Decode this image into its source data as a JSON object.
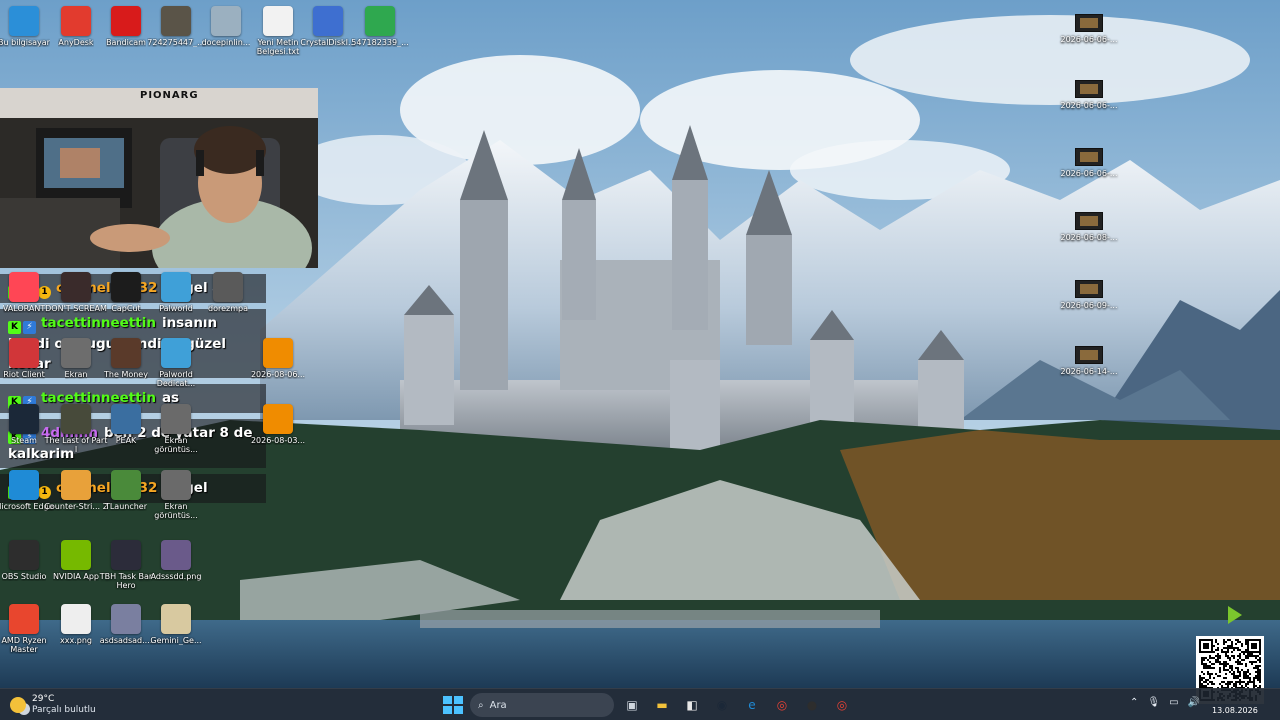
{
  "desktop": {
    "top_row": [
      {
        "label": "Bu bilgisayar",
        "icon": "monitor-icon",
        "color": "#2b8fd8"
      },
      {
        "label": "AnyDesk",
        "icon": "anydesk-icon",
        "color": "#e23b2e"
      },
      {
        "label": "Bandicam",
        "icon": "record-icon",
        "color": "#d81b1b"
      },
      {
        "label": "724275447_...",
        "icon": "image-thumb-icon",
        "color": "#5a5448"
      },
      {
        "label": "docepinlin...",
        "icon": "image-thumb-icon",
        "color": "#9bb0c0"
      },
      {
        "label": "Yeni Metin Belgesi.txt",
        "icon": "text-file-icon",
        "color": "#f2f2f2"
      },
      {
        "label": "CrystalDiskI...",
        "icon": "crystaldisk-icon",
        "color": "#3e6fd0"
      },
      {
        "label": "547182339_...",
        "icon": "image-thumb-icon",
        "color": "#2fa84f"
      }
    ],
    "left_column": [
      {
        "label": "VALORANT",
        "icon": "valorant-icon",
        "color": "#ff4655"
      },
      {
        "label": "Riot Client",
        "icon": "riot-icon",
        "color": "#d13639"
      },
      {
        "label": "Steam",
        "icon": "steam-icon",
        "color": "#1b2838"
      },
      {
        "label": "Microsoft Edge",
        "icon": "edge-icon",
        "color": "#1f8bd6"
      },
      {
        "label": "OBS Studio",
        "icon": "obs-icon",
        "color": "#2d2d2d"
      },
      {
        "label": "AMD Ryzen Master",
        "icon": "amd-icon",
        "color": "#e8462e"
      }
    ],
    "second_column": [
      {
        "label": "DON'T SCREAM",
        "icon": "game-icon",
        "color": "#3a2b2b"
      },
      {
        "label": "Ekran",
        "icon": "image-thumb-icon",
        "color": "#6d6d6d"
      },
      {
        "label": "The Last of Part I",
        "icon": "game-icon",
        "color": "#474a3a"
      },
      {
        "label": "Counter-Stri... 2",
        "icon": "cs2-icon",
        "color": "#e8a13a"
      },
      {
        "label": "NVIDIA App",
        "icon": "nvidia-icon",
        "color": "#76b900"
      },
      {
        "label": "xxx.png",
        "icon": "image-thumb-icon",
        "color": "#eeeeee"
      }
    ],
    "third_column": [
      {
        "label": "CapCut",
        "icon": "capcut-icon",
        "color": "#1c1c1c"
      },
      {
        "label": "The Money",
        "icon": "game-icon",
        "color": "#5a3a2a"
      },
      {
        "label": "PEAK",
        "icon": "peak-icon",
        "color": "#3a6ea0"
      },
      {
        "label": "TLauncher",
        "icon": "tlauncher-icon",
        "color": "#4a8a3a"
      },
      {
        "label": "TBH Task Bar Hero",
        "icon": "game-icon",
        "color": "#2c2c3a"
      },
      {
        "label": "asdsadsad....",
        "icon": "image-thumb-icon",
        "color": "#7a7fa0"
      }
    ],
    "fourth_column": [
      {
        "label": "Palworld",
        "icon": "palworld-icon",
        "color": "#3fa0d8"
      },
      {
        "label": "Palworld Dedicat...",
        "icon": "palworld-icon",
        "color": "#3fa0d8"
      },
      {
        "label": "Ekran görüntüs...",
        "icon": "image-thumb-icon",
        "color": "#6a6a6a"
      },
      {
        "label": "Ekran görüntüs...",
        "icon": "image-thumb-icon",
        "color": "#6a6a6a"
      },
      {
        "label": "Adsssdd.png",
        "icon": "image-thumb-icon",
        "color": "#6a5a8a"
      },
      {
        "label": "Gemini_Ge...",
        "icon": "image-thumb-icon",
        "color": "#d8c9a0"
      }
    ],
    "fifth_column": [
      {
        "label": "dorezmpa",
        "icon": "image-thumb-icon",
        "color": "#5a5a5a"
      },
      {
        "label": "2026-08-06...",
        "icon": "vlc-icon",
        "color": "#f08c00"
      },
      {
        "label": "2026-08-03...",
        "icon": "vlc-icon",
        "color": "#f08c00"
      }
    ],
    "right_column": [
      {
        "label": "2026-06-06-..."
      },
      {
        "label": "2026-06-06-..."
      },
      {
        "label": "2026-06-06-..."
      },
      {
        "label": "2026-06-08-..."
      },
      {
        "label": "2026-06-09-..."
      },
      {
        "label": "2026-06-14-..."
      }
    ]
  },
  "webcam": {
    "shirt_text": "PIONARG"
  },
  "chat": [
    {
      "badges": [
        "k",
        "cube",
        "one"
      ],
      "user": "chameleon32",
      "user_color": "#f5a623",
      "text": "cs gel aq"
    },
    {
      "badges": [
        "k",
        "bolt"
      ],
      "user": "tacettinneettin",
      "user_color": "#53fc18",
      "text": "insanın kendi ossrugu kendine güzel kokar"
    },
    {
      "badges": [
        "k",
        "bolt"
      ],
      "user": "tacettinneettin",
      "user_color": "#53fc18",
      "text": "as"
    },
    {
      "badges": [
        "k",
        "bolt"
      ],
      "user": "4dminn",
      "user_color": "#c86bf0",
      "text": "ben 2 de yatar 8 de kalkarim"
    },
    {
      "badges": [
        "k",
        "cube",
        "one"
      ],
      "user": "chameleon32",
      "user_color": "#f5a623",
      "text": "cs gel"
    }
  ],
  "taskbar": {
    "weather_temp": "29°C",
    "weather_desc": "Parçalı bulutlu",
    "search_placeholder": "Ara",
    "date": "13.08.2026",
    "apps": [
      {
        "name": "task-view-icon",
        "color": "#cfd6de"
      },
      {
        "name": "file-explorer-icon",
        "color": "#f2c23b"
      },
      {
        "name": "app-icon",
        "color": "#e8e8e8"
      },
      {
        "name": "steam-icon",
        "color": "#1b2838"
      },
      {
        "name": "edge-icon",
        "color": "#1f8bd6"
      },
      {
        "name": "chrome-icon",
        "color": "#e94235"
      },
      {
        "name": "obs-icon",
        "color": "#2d2d2d"
      },
      {
        "name": "chrome-icon",
        "color": "#e94235"
      }
    ]
  }
}
